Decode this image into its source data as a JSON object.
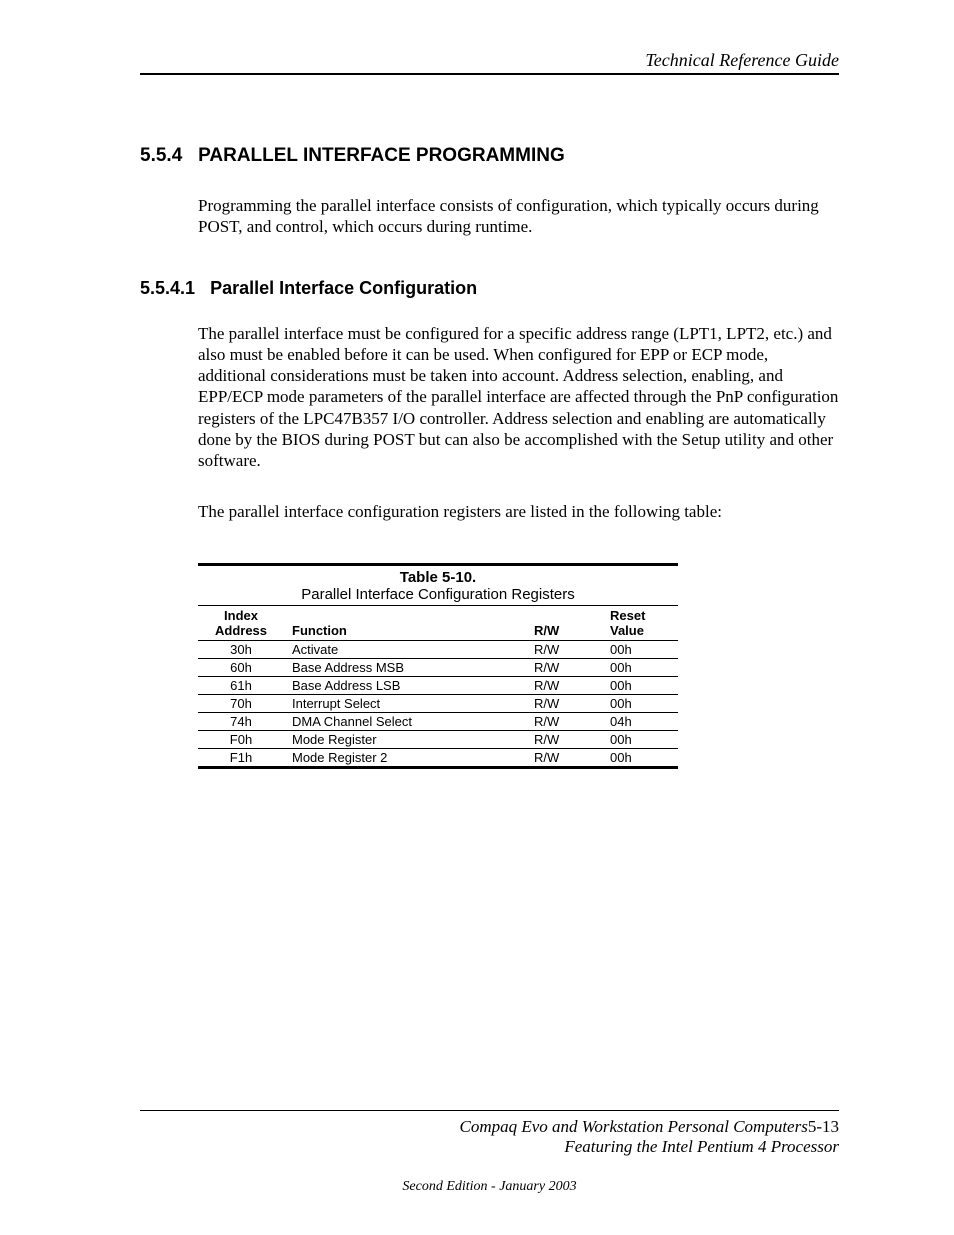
{
  "header": {
    "running_title": "Technical Reference Guide"
  },
  "section1": {
    "number": "5.5.4",
    "title": "PARALLEL INTERFACE PROGRAMMING",
    "p1": "Programming the parallel interface consists of configuration, which typically occurs during POST, and control, which occurs during runtime."
  },
  "section2": {
    "number": "5.5.4.1",
    "title": "Parallel Interface Configuration",
    "p1": "The parallel interface must be configured for a specific address range (LPT1, LPT2, etc.) and also must be enabled before it can be used. When configured for EPP or ECP mode, additional considerations must be taken into account.  Address selection, enabling, and EPP/ECP mode parameters of the parallel interface are affected through the PnP configuration registers of the LPC47B357 I/O controller. Address selection and enabling are automatically done by the BIOS during POST but can also be accomplished with the Setup utility and other software.",
    "p2": "The parallel interface configuration registers are listed in the following table:"
  },
  "table": {
    "label": "Table 5-10.",
    "caption": "Parallel Interface Configuration Registers",
    "headers": {
      "col1a": "Index",
      "col1b": "Address",
      "col2": "Function",
      "col3": "R/W",
      "col4a": "Reset",
      "col4b": "Value"
    },
    "rows": [
      {
        "addr": "30h",
        "func": "Activate",
        "rw": "R/W",
        "reset": "00h"
      },
      {
        "addr": "60h",
        "func": "Base Address MSB",
        "rw": "R/W",
        "reset": "00h"
      },
      {
        "addr": "61h",
        "func": "Base Address LSB",
        "rw": "R/W",
        "reset": "00h"
      },
      {
        "addr": "70h",
        "func": "Interrupt Select",
        "rw": "R/W",
        "reset": "00h"
      },
      {
        "addr": "74h",
        "func": "DMA Channel Select",
        "rw": "R/W",
        "reset": "04h"
      },
      {
        "addr": "F0h",
        "func": "Mode Register",
        "rw": "R/W",
        "reset": "00h"
      },
      {
        "addr": "F1h",
        "func": "Mode Register 2",
        "rw": "R/W",
        "reset": "00h"
      }
    ]
  },
  "footer": {
    "line1_text": "Compaq Evo and Workstation Personal Computers",
    "page_no": "5-13",
    "line2": "Featuring the Intel Pentium 4 Processor",
    "edition": "Second Edition - January 2003"
  }
}
